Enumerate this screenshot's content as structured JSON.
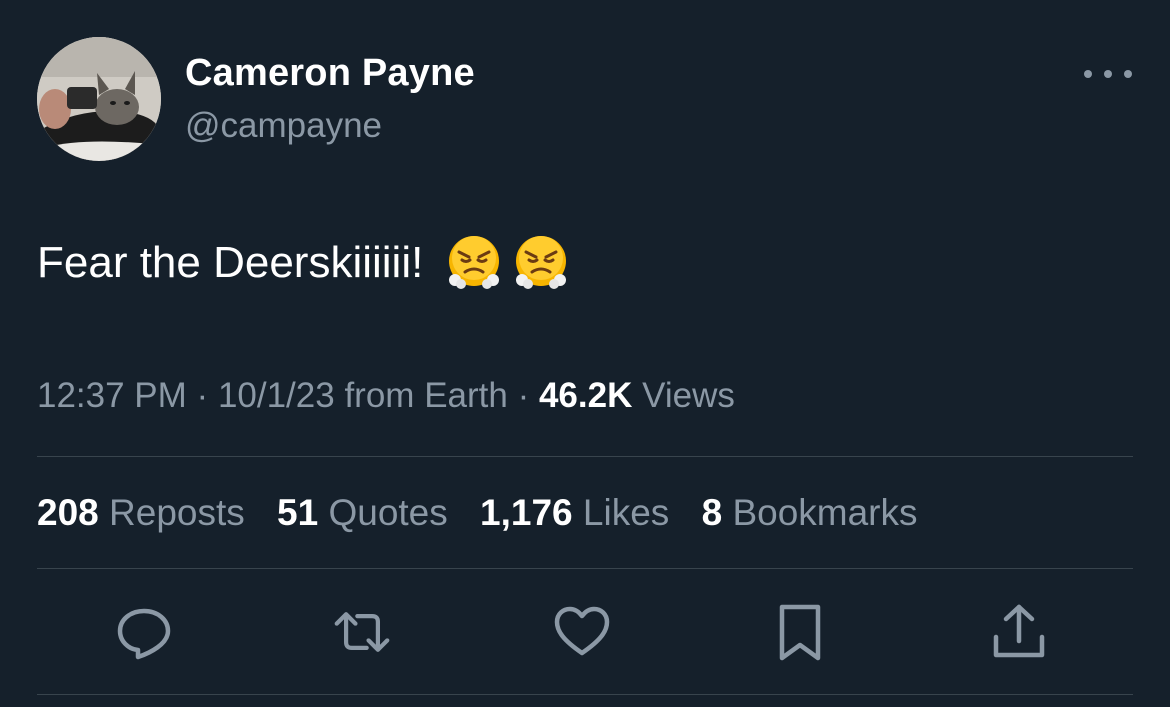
{
  "author": {
    "display_name": "Cameron Payne",
    "handle": "@campayne",
    "avatar": "avatar"
  },
  "more_icon": "more-horizontal-icon",
  "tweet": {
    "text": "Fear the Deerskiiiiii!",
    "emojis": [
      "face-with-steam-from-nose",
      "face-with-steam-from-nose"
    ]
  },
  "meta": {
    "time": "12:37 PM",
    "sep1": "·",
    "date": "10/1/23",
    "source_prefix": "from",
    "source": "Earth",
    "sep2": "·",
    "views_count": "46.2K",
    "views_label": "Views"
  },
  "stats": {
    "reposts_count": "208",
    "reposts_label": "Reposts",
    "quotes_count": "51",
    "quotes_label": "Quotes",
    "likes_count": "1,176",
    "likes_label": "Likes",
    "bookmarks_count": "8",
    "bookmarks_label": "Bookmarks"
  },
  "actions": [
    "reply-icon",
    "repost-icon",
    "like-icon",
    "bookmark-icon",
    "share-icon"
  ],
  "colors": {
    "background": "#15202b",
    "primary_text": "#ffffff",
    "secondary_text": "#8b98a5",
    "divider": "#38444d"
  }
}
